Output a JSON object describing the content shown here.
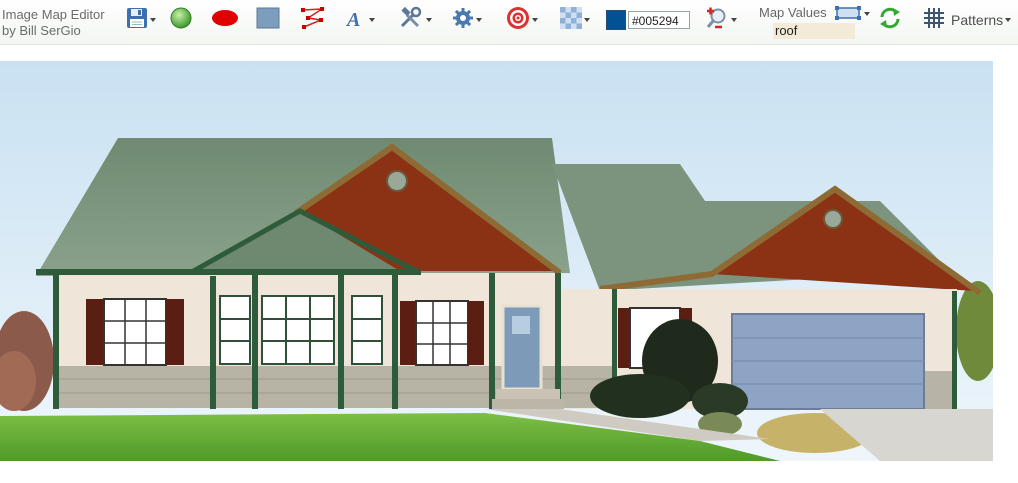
{
  "app": {
    "title_line1": "Image Map Editor",
    "title_line2": "by Bill SerGio"
  },
  "toolbar": {
    "tools": [
      {
        "name": "save",
        "icon": "floppy-disk-icon",
        "has_dropdown": true
      },
      {
        "name": "circle",
        "icon": "green-circle-icon",
        "has_dropdown": false
      },
      {
        "name": "ellipse",
        "icon": "red-ellipse-icon",
        "has_dropdown": false
      },
      {
        "name": "rectangle",
        "icon": "blue-rectangle-icon",
        "has_dropdown": false
      },
      {
        "name": "polygon",
        "icon": "polygon-points-icon",
        "has_dropdown": false
      },
      {
        "name": "text",
        "icon": "text-a-icon",
        "has_dropdown": true
      },
      {
        "name": "tools",
        "icon": "wrench-hammer-icon",
        "has_dropdown": true
      },
      {
        "name": "settings",
        "icon": "gear-icon",
        "has_dropdown": true
      },
      {
        "name": "target",
        "icon": "target-icon",
        "has_dropdown": true
      },
      {
        "name": "transparency",
        "icon": "checkerboard-icon",
        "has_dropdown": true
      },
      {
        "name": "zoom",
        "icon": "zoom-plus-minus-icon",
        "has_dropdown": true
      },
      {
        "name": "refresh",
        "icon": "refresh-arrows-icon",
        "has_dropdown": false
      }
    ],
    "color": {
      "value": "#005294",
      "swatch": "#005294"
    },
    "map_values": {
      "label": "Map Values",
      "value": "roof"
    },
    "patterns": {
      "label": "Patterns",
      "icon": "grid-hash-icon"
    }
  },
  "canvas": {
    "image": "house-illustration",
    "alt": "ranch house with green roof, brown gables and blue garage door"
  }
}
